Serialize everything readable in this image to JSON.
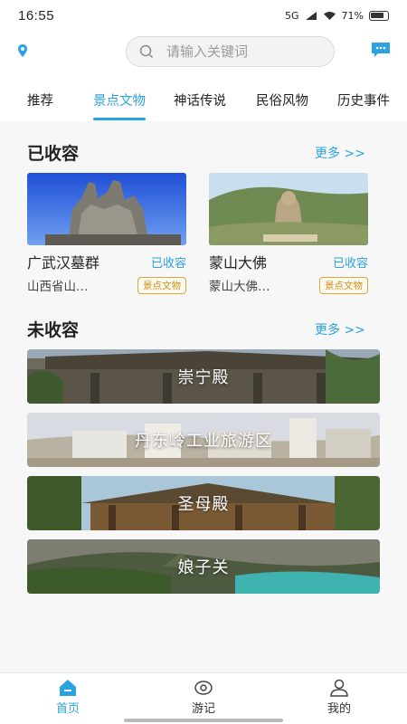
{
  "status_bar": {
    "time": "16:55",
    "network": "5G",
    "battery": "71%"
  },
  "header": {
    "search_placeholder": "请输入关键词"
  },
  "tabs": [
    {
      "label": "推荐",
      "active": false
    },
    {
      "label": "景点文物",
      "active": true
    },
    {
      "label": "神话传说",
      "active": false
    },
    {
      "label": "民俗风物",
      "active": false
    },
    {
      "label": "历史事件",
      "active": false
    }
  ],
  "collected": {
    "title": "已收容",
    "more": "更多 >>",
    "items": [
      {
        "name": "广武汉墓群",
        "status": "已收容",
        "location": "山西省山…",
        "tag": "景点文物"
      },
      {
        "name": "蒙山大佛",
        "status": "已收容",
        "location": "蒙山大佛…",
        "tag": "景点文物"
      }
    ]
  },
  "uncollected": {
    "title": "未收容",
    "more": "更多 >>",
    "items": [
      {
        "name": "崇宁殿"
      },
      {
        "name": "丹东岭工业旅游区"
      },
      {
        "name": "圣母殿"
      },
      {
        "name": "娘子关"
      }
    ]
  },
  "bottom_nav": [
    {
      "label": "首页",
      "icon": "home-icon",
      "active": true
    },
    {
      "label": "游记",
      "icon": "eye-icon",
      "active": false
    },
    {
      "label": "我的",
      "icon": "user-icon",
      "active": false
    }
  ],
  "colors": {
    "accent": "#2aa3e0",
    "tag": "#c8901a"
  }
}
